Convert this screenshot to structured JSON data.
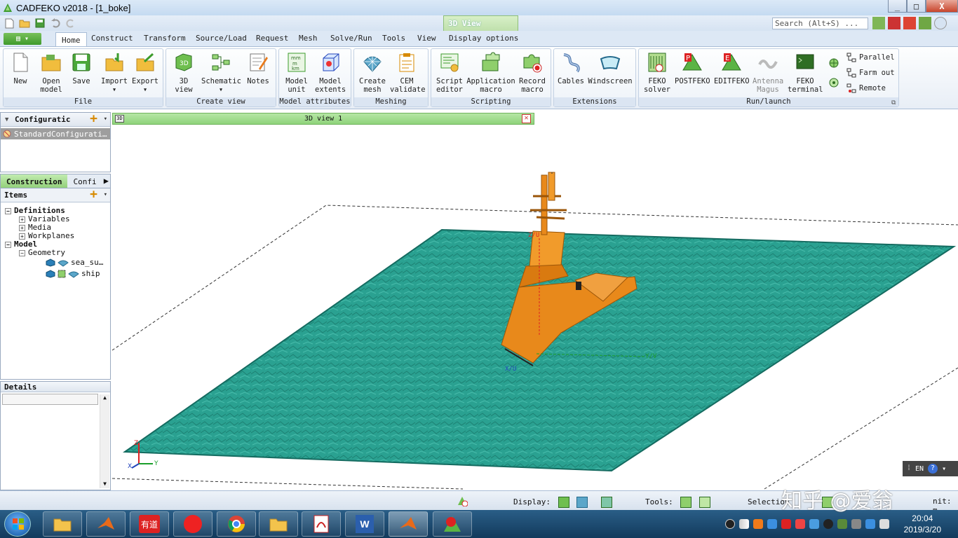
{
  "window": {
    "title": "CADFEKO v2018 - [1_boke]",
    "minimize": "_",
    "maximize": "□",
    "close": "X"
  },
  "contextual_tab": "3D View",
  "search": {
    "placeholder": "Search (Alt+S) ..."
  },
  "tabs": [
    "Home",
    "Construct",
    "Transform",
    "Source/Load",
    "Request",
    "Mesh",
    "Solve/Run",
    "Tools",
    "View",
    "Display options"
  ],
  "ribbon": {
    "groups": [
      "File",
      "Create view",
      "Model attributes",
      "Meshing",
      "Scripting",
      "Extensions",
      "Run/launch"
    ],
    "buttons": {
      "new": "New",
      "open_model_1": "Open",
      "open_model_2": "model",
      "save": "Save",
      "import": "Import",
      "export": "Export",
      "view3d_1": "3D",
      "view3d_2": "view",
      "schematic": "Schematic",
      "notes": "Notes",
      "model_unit_1": "Model",
      "model_unit_2": "unit",
      "model_extents_1": "Model",
      "model_extents_2": "extents",
      "create_mesh_1": "Create",
      "create_mesh_2": "mesh",
      "cem_validate_1": "CEM",
      "cem_validate_2": "validate",
      "script_editor_1": "Script",
      "script_editor_2": "editor",
      "app_macro_1": "Application",
      "app_macro_2": "macro",
      "record_macro_1": "Record",
      "record_macro_2": "macro",
      "cables": "Cables",
      "windscreen": "Windscreen",
      "feko_solver_1": "FEKO",
      "feko_solver_2": "solver",
      "postfeko": "POSTFEKO",
      "editfeko": "EDITFEKO",
      "antenna_magus_1": "Antenna",
      "antenna_magus_2": "Magus",
      "feko_terminal_1": "FEKO",
      "feko_terminal_2": "terminal",
      "parallel": "Parallel",
      "farm_out": "Farm out",
      "remote": "Remote"
    }
  },
  "config_panel": {
    "title": "Configuratic",
    "item": "StandardConfigurati…"
  },
  "tree_panel": {
    "tabs": [
      "Construction",
      "Confi"
    ],
    "items_label": "Items",
    "nodes": {
      "definitions": "Definitions",
      "variables": "Variables",
      "media": "Media",
      "workplanes": "Workplanes",
      "model": "Model",
      "geometry": "Geometry",
      "sea": "sea_su…",
      "ship": "ship"
    }
  },
  "details_panel": {
    "title": "Details"
  },
  "view": {
    "tab_title": "3D view 1",
    "tab_icon": "3D",
    "axis_labels": {
      "z": "Z/U",
      "y": "Y/V",
      "x": "X/U"
    },
    "triad": {
      "z": "Z",
      "x": "X",
      "y": "Y"
    },
    "colors": {
      "sea": "#2aa191",
      "ship": "#e8891b",
      "sea_edge": "#146b60"
    }
  },
  "lang_widget": {
    "code": "EN",
    "help": "?"
  },
  "statusbar": {
    "display_label": "Display:",
    "tools_label": "Tools:",
    "selection_label": "Selection",
    "unit_label": "nit: m"
  },
  "taskbar": {
    "apps": [
      "explorer",
      "matlab",
      "youdao",
      "netease-music",
      "chrome",
      "folder",
      "acrobat",
      "word",
      "matlab-active",
      "cadfeko"
    ],
    "youdao_text": "有道",
    "clock_time": "20:04",
    "clock_date": "2019/3/20"
  },
  "watermark": "知乎 @爱翁"
}
